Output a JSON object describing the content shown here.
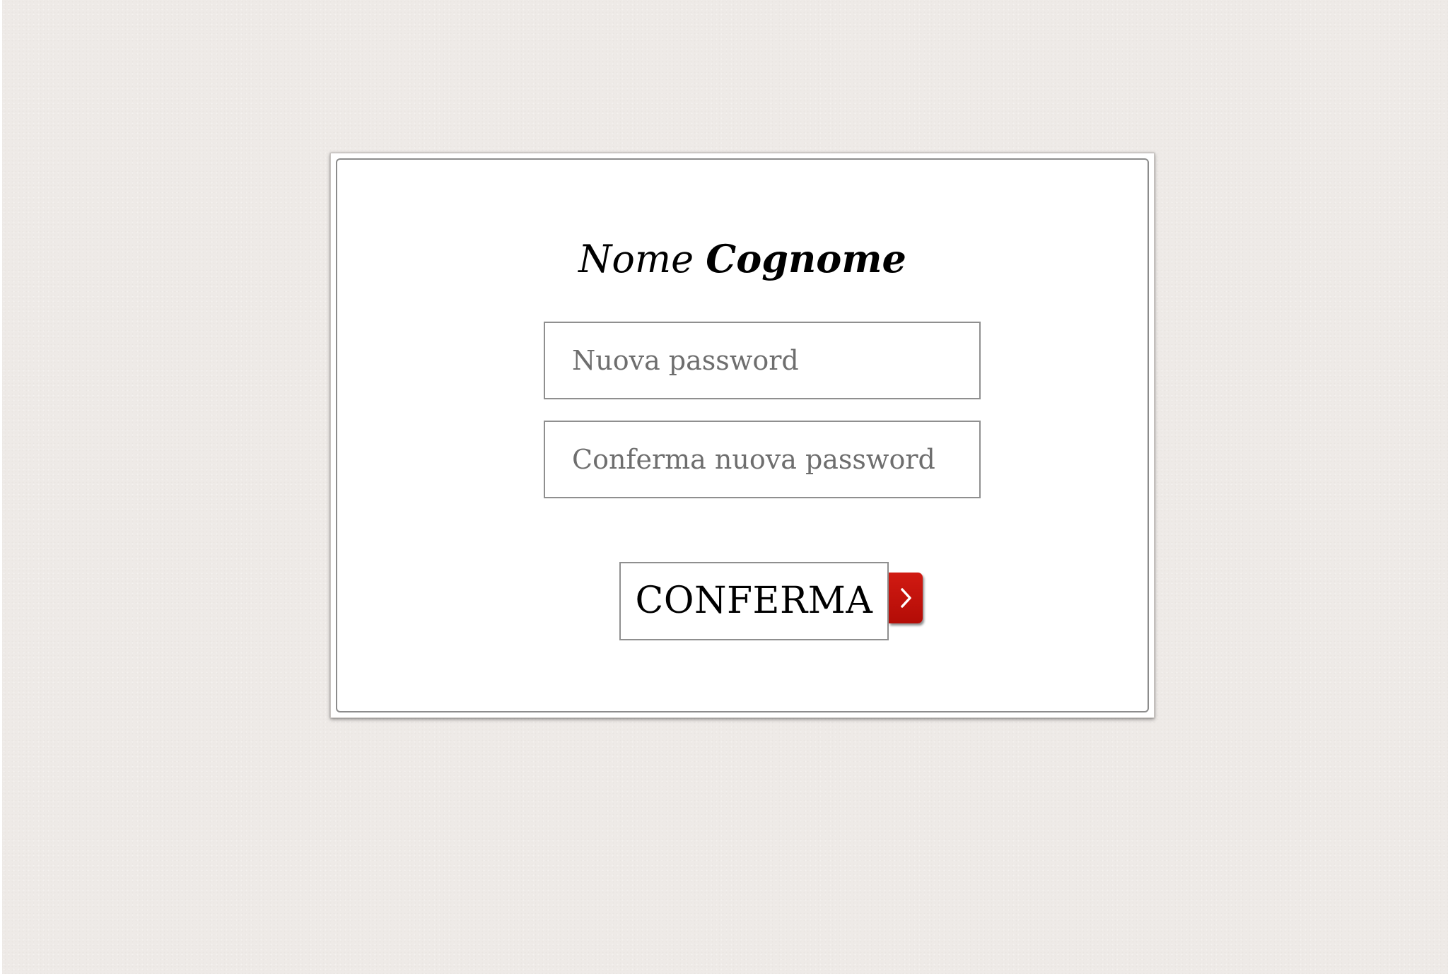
{
  "card": {
    "title_first": "Nome",
    "title_last": "Cognome"
  },
  "form": {
    "new_password_placeholder": "Nuova password",
    "new_password_value": "",
    "confirm_password_placeholder": "Conferma nuova password",
    "confirm_password_value": "",
    "submit_label": "CONFERMA",
    "submit_icon": "chevron-right-icon"
  },
  "colors": {
    "page_background": "#eeeae7",
    "card_background": "#ffffff",
    "accent": "#c4110a",
    "field_border": "#8f8f8f",
    "placeholder_text": "#6e6e6e"
  }
}
